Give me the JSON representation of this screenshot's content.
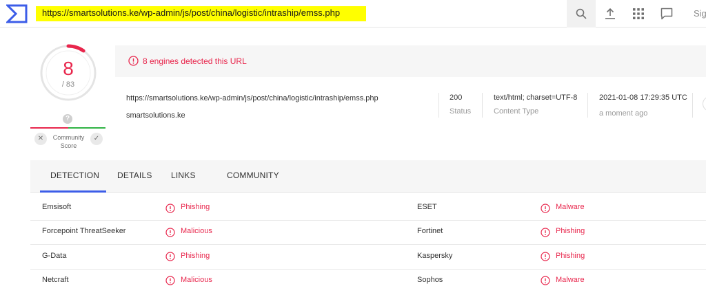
{
  "topbar": {
    "url": "https://smartsolutions.ke/wp-admin/js/post/china/logistic/intraship/emss.php",
    "signin_label": "Sig"
  },
  "score": {
    "detections": "8",
    "total": "/ 83",
    "fraction": 0.096,
    "help": "?",
    "community_label": "Community Score",
    "vote_down": "✕",
    "vote_up": "✓"
  },
  "banner": {
    "text": "8 engines detected this URL"
  },
  "info": {
    "url": "https://smartsolutions.ke/wp-admin/js/post/china/logistic/intraship/emss.php",
    "domain": "smartsolutions.ke",
    "status_value": "200",
    "status_label": "Status",
    "content_type_value": "text/html; charset=UTF-8",
    "content_type_label": "Content Type",
    "date_value": "2021-01-08 17:29:35 UTC",
    "date_label": "a moment ago"
  },
  "tabs": [
    "DETECTION",
    "DETAILS",
    "LINKS",
    "COMMUNITY"
  ],
  "detections": [
    {
      "left_engine": "Emsisoft",
      "left_result": "Phishing",
      "right_engine": "ESET",
      "right_result": "Malware"
    },
    {
      "left_engine": "Forcepoint ThreatSeeker",
      "left_result": "Malicious",
      "right_engine": "Fortinet",
      "right_result": "Phishing"
    },
    {
      "left_engine": "G-Data",
      "left_result": "Phishing",
      "right_engine": "Kaspersky",
      "right_result": "Phishing"
    },
    {
      "left_engine": "Netcraft",
      "left_result": "Malicious",
      "right_engine": "Sophos",
      "right_result": "Malware"
    }
  ],
  "colors": {
    "accent": "#3c5de8",
    "danger": "#e8264c",
    "ok": "#2fb344",
    "highlight": "#ffff00"
  }
}
